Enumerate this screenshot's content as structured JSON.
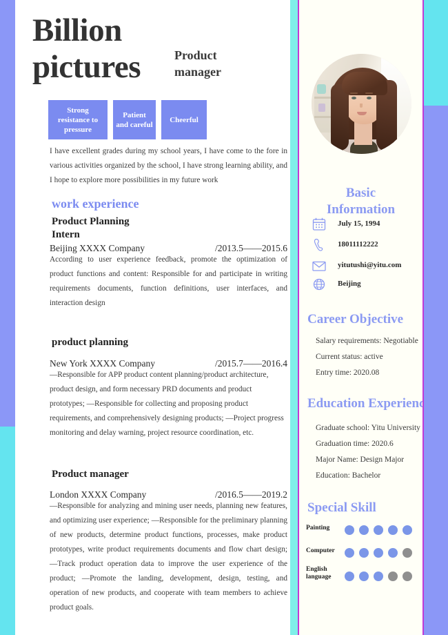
{
  "colors": {
    "accent_periwinkle": "#8b97f7",
    "accent_cyan": "#64e4ef",
    "accent_magenta": "#c13ad4",
    "tag_bg": "#7b8bf0",
    "heading_blue": "#8b9af2",
    "dot_on": "#7b96e8",
    "dot_off": "#8f8f8f"
  },
  "header": {
    "name_line1": "Billion",
    "name_line2": "pictures",
    "job_title_line1": "Product",
    "job_title_line2": "manager",
    "tags": [
      "Strong resistance to pressure",
      "Patient and careful",
      "Cheerful"
    ],
    "summary": "I have excellent grades during my school years, I have come to the fore in various activities organized by the school, I have strong learning ability, and I hope to explore more possibilities in my future work"
  },
  "work_experience": {
    "section_title": "work experience",
    "jobs": [
      {
        "role": "Product Planning Intern",
        "role_line1": "Product Planning",
        "role_line2": "Intern",
        "company": "Beijing XXXX Company",
        "dates": "/2013.5——2015.6",
        "body": "According to user experience feedback, promote the optimization of product functions and content: Responsible for and participate in writing requirements documents, function definitions, user interfaces, and interaction design"
      },
      {
        "role": "product planning",
        "company": "New York XXXX Company",
        "dates": "/2015.7——2016.4",
        "body": "—Responsible for APP product content planning/product architecture, product design, and form necessary PRD documents and product prototypes; —Responsible for collecting and proposing product requirements, and comprehensively designing products; —Project progress monitoring and delay warning, project resource coordination, etc."
      },
      {
        "role": "Product manager",
        "company": "London XXXX Company",
        "dates": "/2016.5——2019.2",
        "body": "—Responsible for analyzing and mining user needs, planning new features, and optimizing user experience; —Responsible for the preliminary planning of new products, determine product functions, processes, make product prototypes, write product requirements documents and flow chart design; —Track product operation data to improve the user experience of the product; —Promote the landing, development, design, testing, and operation of new products, and cooperate with team members to achieve product goals."
      }
    ]
  },
  "sidebar": {
    "photo_alt": "portrait-photo",
    "basic_information": {
      "title_line1": "Basic",
      "title_line2": "Information",
      "rows": [
        {
          "icon": "calendar-icon",
          "value": "July 15, 1994"
        },
        {
          "icon": "phone-icon",
          "value": "18011112222"
        },
        {
          "icon": "envelope-icon",
          "value": "yitutushi@yitu.com"
        },
        {
          "icon": "globe-icon",
          "value": "Beijing"
        }
      ]
    },
    "career_objective": {
      "title": "Career Objective",
      "lines": [
        "Salary requirements: Negotiable",
        "Current status: active",
        "Entry time: 2020.08"
      ]
    },
    "education_experience": {
      "title": "Education Experience",
      "lines": [
        "Graduate school: Yitu University",
        "Graduation time: 2020.6",
        "Major Name: Design Major",
        "Education: Bachelor"
      ]
    },
    "special_skill": {
      "title": "Special Skill",
      "skills": [
        {
          "label": "Painting",
          "label_line1": "Painting",
          "label_line2": "",
          "filled": 5,
          "total": 5
        },
        {
          "label": "Computer",
          "label_line1": "Computer",
          "label_line2": "",
          "filled": 4,
          "total": 5
        },
        {
          "label": "English language",
          "label_line1": "English",
          "label_line2": "language",
          "filled": 3,
          "total": 5
        }
      ]
    }
  }
}
